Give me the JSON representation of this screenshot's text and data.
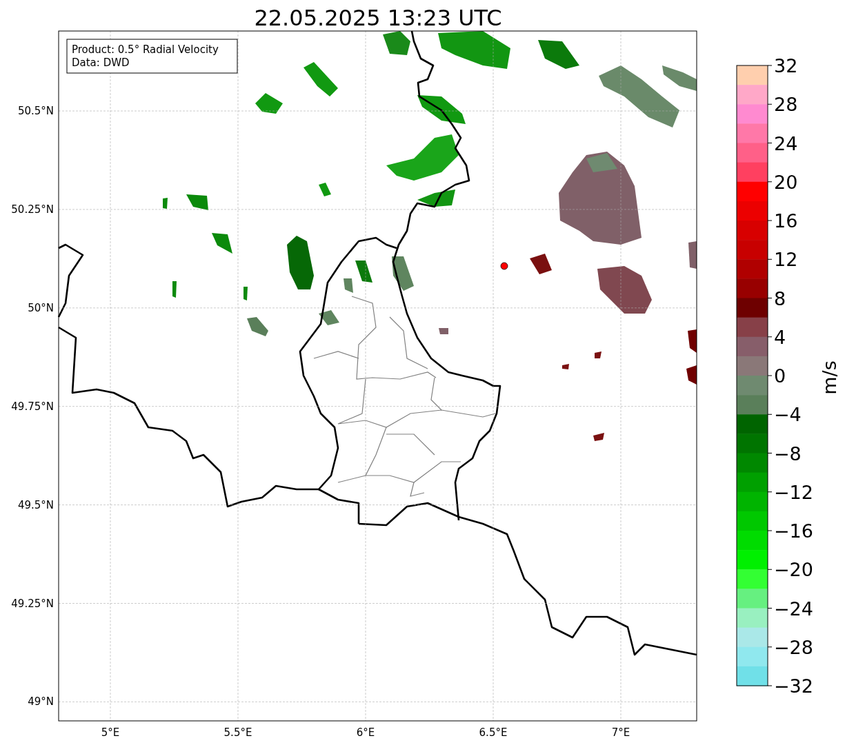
{
  "title": "22.05.2025 13:23 UTC",
  "legend": [
    "Product: 0.5° Radial Velocity",
    "Data: DWD"
  ],
  "map": {
    "lat_ticks": [
      "50.5°N",
      "50.25°N",
      "50°N",
      "49.75°N",
      "49.5°N",
      "49.25°N",
      "49°N"
    ],
    "lon_ticks": [
      "5°E",
      "5.5°E",
      "6°E",
      "6.5°E",
      "7°E"
    ]
  },
  "colorbar": {
    "label": "m/s",
    "ticks": [
      "32",
      "28",
      "24",
      "20",
      "16",
      "12",
      "8",
      "4",
      "0",
      "−4",
      "−8",
      "−12",
      "−16",
      "−20",
      "−24",
      "−28",
      "−32"
    ],
    "bands": [
      {
        "color": "#ffcfae"
      },
      {
        "color": "#ffa8c8"
      },
      {
        "color": "#ff8ad0"
      },
      {
        "color": "#ff78a8"
      },
      {
        "color": "#ff6088"
      },
      {
        "color": "#ff4060"
      },
      {
        "color": "#ff0000"
      },
      {
        "color": "#ec0000"
      },
      {
        "color": "#d80000"
      },
      {
        "color": "#c80000"
      },
      {
        "color": "#b00000"
      },
      {
        "color": "#980000"
      },
      {
        "color": "#6e0000"
      },
      {
        "color": "#874048"
      },
      {
        "color": "#875e6a"
      },
      {
        "color": "#8a7878"
      },
      {
        "color": "#6f8a70"
      },
      {
        "color": "#5a7f5a"
      },
      {
        "color": "#006400"
      },
      {
        "color": "#007400"
      },
      {
        "color": "#008800"
      },
      {
        "color": "#00a000"
      },
      {
        "color": "#00b400"
      },
      {
        "color": "#00c800"
      },
      {
        "color": "#00dc00"
      },
      {
        "color": "#00f000"
      },
      {
        "color": "#33ff33"
      },
      {
        "color": "#66f080"
      },
      {
        "color": "#99f0c0"
      },
      {
        "color": "#aae8e8"
      },
      {
        "color": "#90e8ee"
      },
      {
        "color": "#70e0e8"
      }
    ]
  }
}
